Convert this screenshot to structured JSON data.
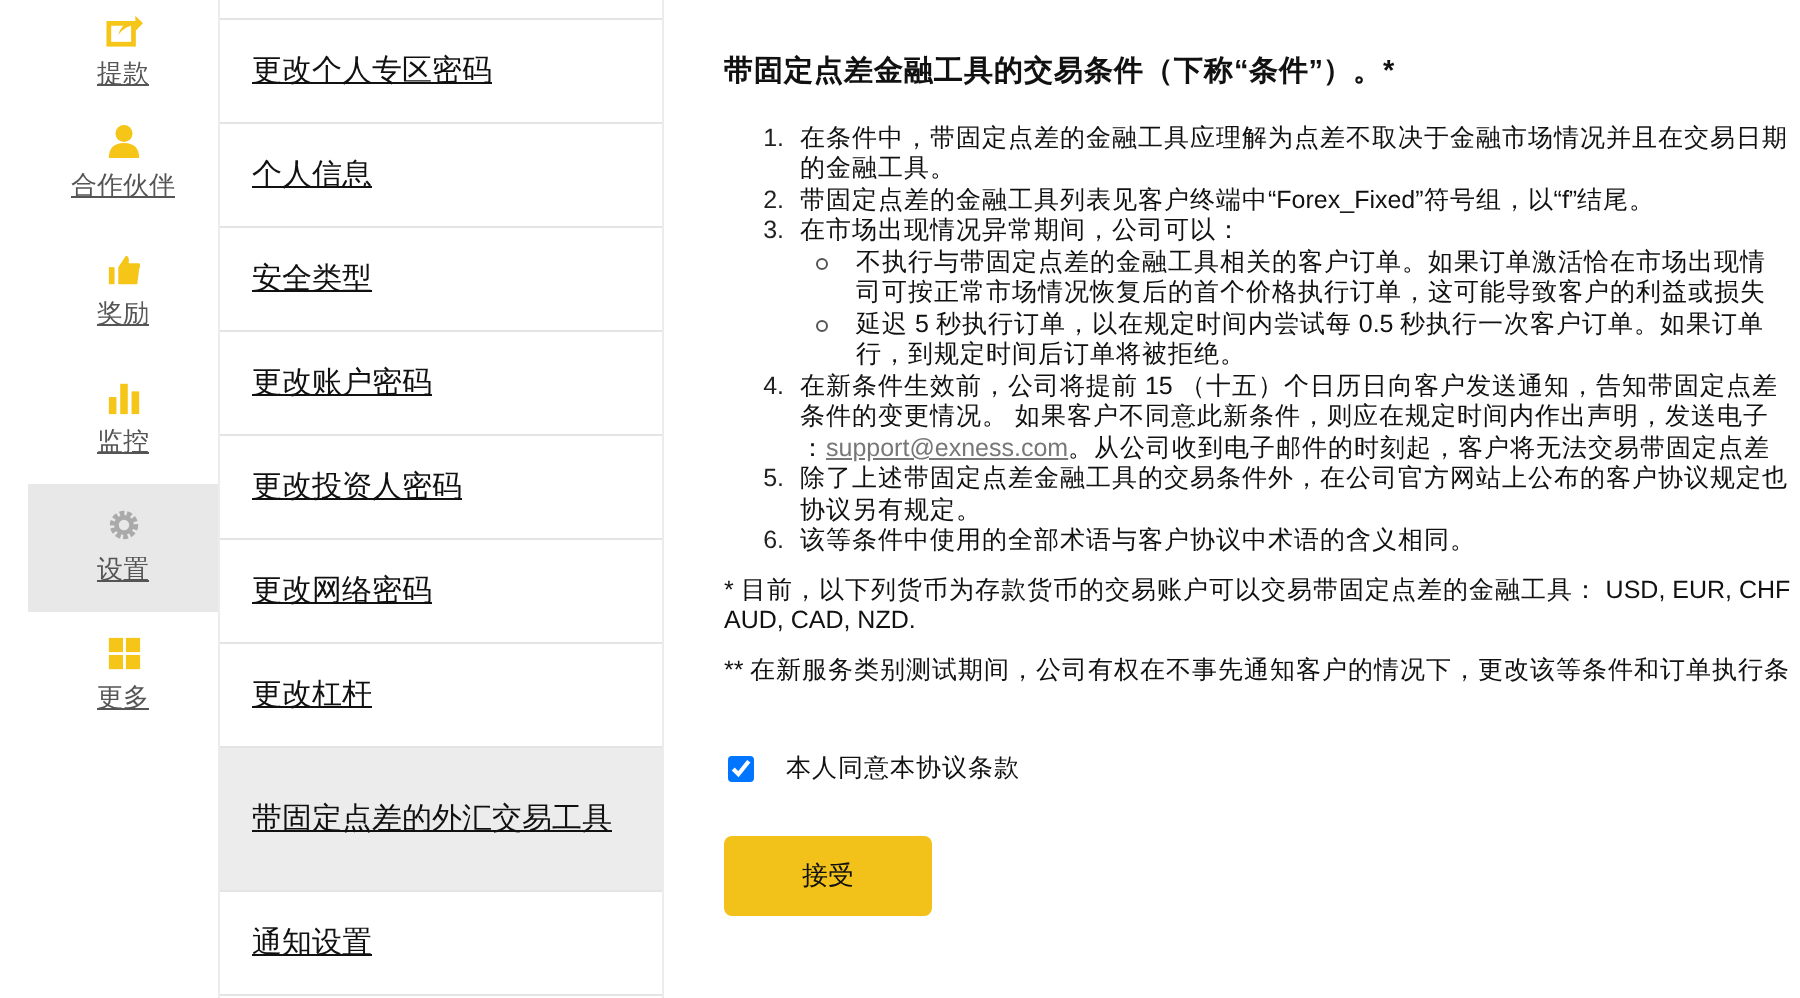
{
  "nav": [
    {
      "label": "提款",
      "selected": false
    },
    {
      "label": "合作伙伴",
      "selected": false
    },
    {
      "label": "奖励",
      "selected": false
    },
    {
      "label": "监控",
      "selected": false
    },
    {
      "label": "设置",
      "selected": true
    },
    {
      "label": "更多",
      "selected": false
    }
  ],
  "menu": [
    {
      "label": "更改个人专区密码",
      "selected": false
    },
    {
      "label": "个人信息",
      "selected": false
    },
    {
      "label": "安全类型",
      "selected": false
    },
    {
      "label": "更改账户密码",
      "selected": false
    },
    {
      "label": "更改投资人密码",
      "selected": false
    },
    {
      "label": "更改网络密码",
      "selected": false
    },
    {
      "label": "更改杠杆",
      "selected": false
    },
    {
      "label": "带固定点差的外汇交易工具",
      "selected": true
    },
    {
      "label": "通知设置",
      "selected": false
    }
  ],
  "title": "带固定点差金融工具的交易条件（下称“条件”）。*",
  "items": [
    {
      "number": "1.",
      "lines": [
        "在条件中，带固定点差的金融工具应理解为点差不取决于金融市场情况并且在交易日期",
        "的金融工具。"
      ]
    },
    {
      "number": "2.",
      "lines": [
        "带固定点差的金融工具列表见客户终端中“Forex_Fixed”符号组，以“f”结尾。"
      ]
    },
    {
      "number": "3.",
      "lines": [
        "在市场出现情况异常期间，公司可以："
      ],
      "children": [
        {
          "lines": [
            "不执行与带固定点差的金融工具相关的客户订单。如果订单激活恰在市场出现情",
            "司可按正常市场情况恢复后的首个价格执行订单，这可能导致客户的利益或损失"
          ]
        },
        {
          "lines": [
            "延迟 5 秒执行订单，以在规定时间内尝试每 0.5 秒执行一次客户订单。如果订单",
            "行，到规定时间后订单将被拒绝。"
          ]
        }
      ]
    },
    {
      "number": "4.",
      "lines": [
        "在新条件生效前，公司将提前 15 （十五）个日历日向客户发送通知，告知带固定点差",
        "条件的变更情况。 如果客户不同意此新条件，则应在规定时间内作出声明，发送电子"
      ],
      "link_prefix": "：",
      "link": "support@exness.com",
      "link_suffix": "。从公司收到电子邮件的时刻起，客户将无法交易带固定点差"
    },
    {
      "number": "5.",
      "lines": [
        "除了上述带固定点差金融工具的交易条件外，在公司官方网站上公布的客户协议规定也",
        "协议另有规定。"
      ]
    },
    {
      "number": "6.",
      "lines": [
        "该等条件中使用的全部术语与客户协议中术语的含义相同。"
      ]
    }
  ],
  "notes": [
    {
      "lines": [
        "* 目前，以下列货币为存款货币的交易账户可以交易带固定点差的金融工具： USD, EUR, CHF",
        "AUD, CAD, NZD."
      ]
    },
    {
      "lines": [
        "** 在新服务类别测试期间，公司有权在不事先通知客户的情况下，更改该等条件和订单执行条"
      ]
    }
  ],
  "agree": {
    "label": "本人同意本协议条款",
    "checked": true
  },
  "button": "接受"
}
